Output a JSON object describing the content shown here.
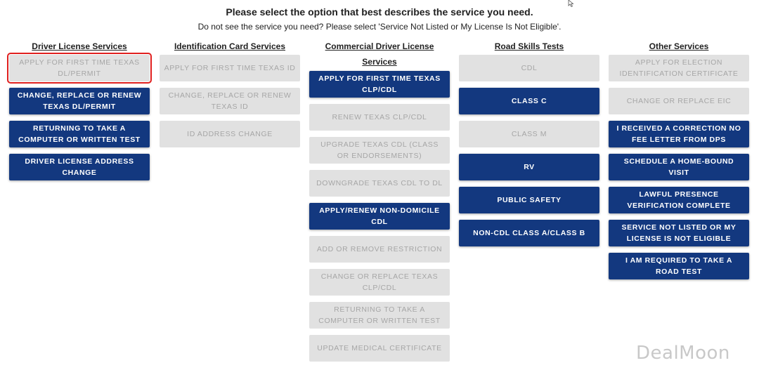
{
  "header": {
    "title": "Please select the option that best describes the service you need.",
    "subtitle": "Do not see the service you need? Please select 'Service Not Listed or My License Is Not Eligible'."
  },
  "columns": [
    {
      "title": "Driver License Services",
      "buttons": [
        {
          "label": "APPLY FOR FIRST TIME TEXAS DL/PERMIT",
          "enabled": false,
          "selected": true
        },
        {
          "label": "CHANGE, REPLACE OR RENEW TEXAS DL/PERMIT",
          "enabled": true
        },
        {
          "label": "RETURNING TO TAKE A COMPUTER OR WRITTEN TEST",
          "enabled": true
        },
        {
          "label": "DRIVER LICENSE ADDRESS CHANGE",
          "enabled": true
        }
      ]
    },
    {
      "title": "Identification Card Services",
      "buttons": [
        {
          "label": "APPLY FOR FIRST TIME TEXAS ID",
          "enabled": false
        },
        {
          "label": "CHANGE, REPLACE OR RENEW TEXAS ID",
          "enabled": false
        },
        {
          "label": "ID ADDRESS CHANGE",
          "enabled": false
        }
      ]
    },
    {
      "title": "Commercial Driver License Services",
      "buttons": [
        {
          "label": "APPLY FOR FIRST TIME TEXAS CLP/CDL",
          "enabled": true
        },
        {
          "label": "RENEW TEXAS CLP/CDL",
          "enabled": false
        },
        {
          "label": "UPGRADE TEXAS CDL (CLASS OR ENDORSEMENTS)",
          "enabled": false
        },
        {
          "label": "DOWNGRADE TEXAS CDL TO DL",
          "enabled": false
        },
        {
          "label": "APPLY/RENEW NON-DOMICILE CDL",
          "enabled": true
        },
        {
          "label": "ADD OR REMOVE RESTRICTION",
          "enabled": false
        },
        {
          "label": "CHANGE OR REPLACE TEXAS CLP/CDL",
          "enabled": false
        },
        {
          "label": "RETURNING TO TAKE A COMPUTER OR WRITTEN TEST",
          "enabled": false
        },
        {
          "label": "UPDATE MEDICAL CERTIFICATE",
          "enabled": false
        }
      ]
    },
    {
      "title": "Road Skills Tests",
      "buttons": [
        {
          "label": "CDL",
          "enabled": false
        },
        {
          "label": "CLASS C",
          "enabled": true
        },
        {
          "label": "CLASS M",
          "enabled": false
        },
        {
          "label": "RV",
          "enabled": true
        },
        {
          "label": "PUBLIC SAFETY",
          "enabled": true
        },
        {
          "label": "NON-CDL CLASS A/CLASS B",
          "enabled": true
        }
      ]
    },
    {
      "title": "Other Services",
      "buttons": [
        {
          "label": "APPLY FOR ELECTION IDENTIFICATION CERTIFICATE",
          "enabled": false
        },
        {
          "label": "CHANGE OR REPLACE EIC",
          "enabled": false
        },
        {
          "label": "I RECEIVED A CORRECTION NO FEE LETTER FROM DPS",
          "enabled": true
        },
        {
          "label": "SCHEDULE A HOME-BOUND VISIT",
          "enabled": true
        },
        {
          "label": "LAWFUL PRESENCE VERIFICATION COMPLETE",
          "enabled": true
        },
        {
          "label": "SERVICE NOT LISTED OR MY LICENSE IS NOT ELIGIBLE",
          "enabled": true
        },
        {
          "label": "I AM REQUIRED TO TAKE A ROAD TEST",
          "enabled": true
        }
      ]
    }
  ],
  "watermark": "DealMoon"
}
